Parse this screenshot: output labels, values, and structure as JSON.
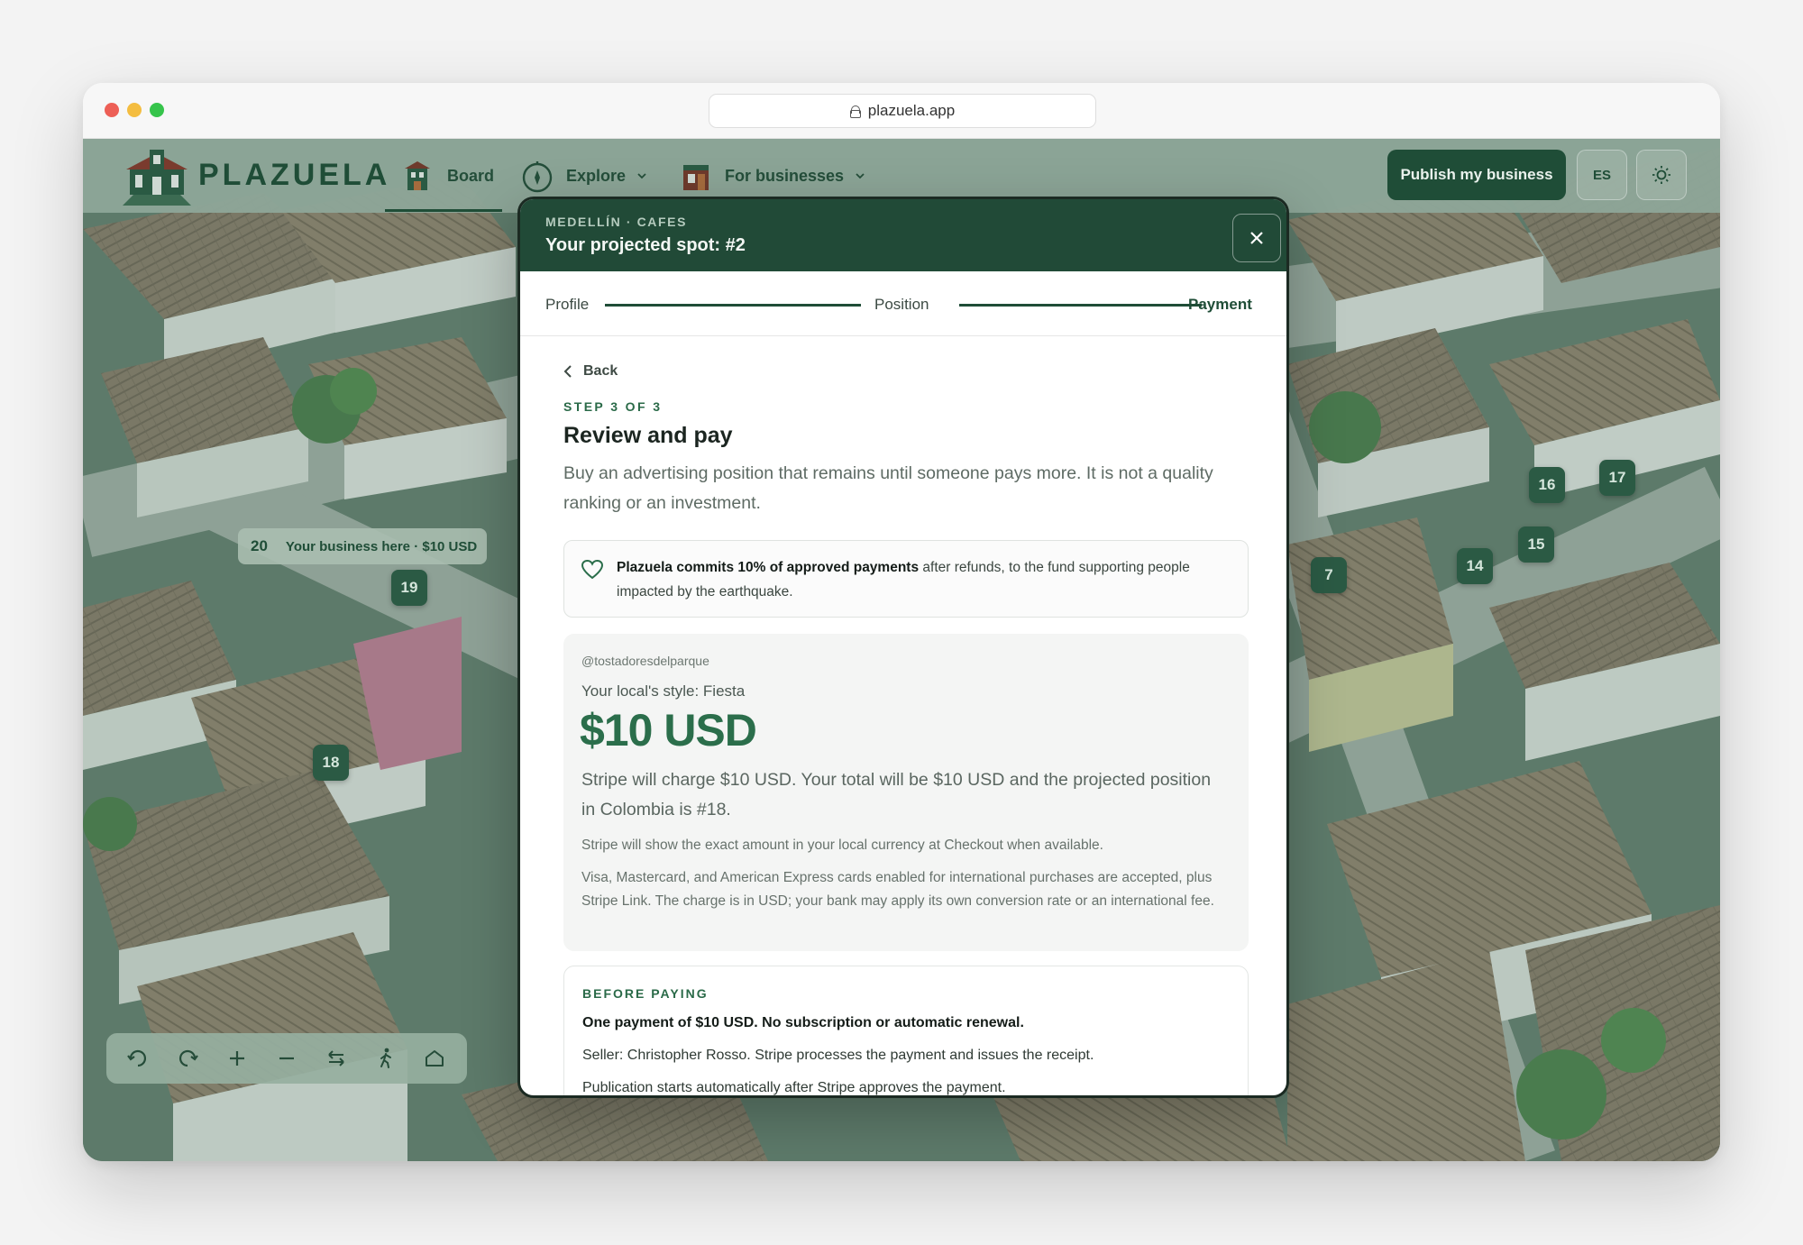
{
  "browser": {
    "url": "plazuela.app"
  },
  "nav": {
    "logo_text": "PLAZUELA",
    "board_label": "Board",
    "explore_label": "Explore",
    "businesses_label": "For businesses",
    "publish_label": "Publish my business",
    "lang_label": "ES"
  },
  "map": {
    "promo": {
      "number": "20",
      "text": "Your business here · $10 USD"
    },
    "markers": [
      "19",
      "18",
      "16",
      "17",
      "15",
      "14",
      "7"
    ]
  },
  "modal": {
    "eyebrow": "MEDELLÍN · CAFES",
    "title": "Your projected spot: #2",
    "steps": [
      "Profile",
      "Position",
      "Payment"
    ],
    "back_label": "Back",
    "step_count": "STEP 3 OF 3",
    "section_title": "Review and pay",
    "lead": "Buy an advertising position that remains until someone pays more. It is not a quality ranking or an investment.",
    "commit_bold": "Plazuela commits 10% of approved payments",
    "commit_rest": " after refunds, to the fund supporting people impacted by the earthquake.",
    "handle": "@tostadoresdelparque",
    "style_line": "Your local's style: Fiesta",
    "price": "$10 USD",
    "charge_text": "Stripe will charge $10 USD. Your total will be $10 USD and the projected position in Colombia is #18.",
    "note_1": "Stripe will show the exact amount in your local currency at Checkout when available.",
    "note_2": "Visa, Mastercard, and American Express cards enabled for international purchases are accepted, plus Stripe Link. The charge is in USD; your bank may apply its own conversion rate or an international fee.",
    "before_title": "BEFORE PAYING",
    "before_1": "One payment of $10 USD. No subscription or automatic renewal.",
    "before_2": "Seller: Christopher Rosso. Stripe processes the payment and issues the receipt.",
    "before_3": "Publication starts automatically after Stripe approves the payment."
  },
  "colors": {
    "brand_green": "#1f4d37",
    "accent_green": "#2b6e4b",
    "header_green": "#214a37"
  }
}
